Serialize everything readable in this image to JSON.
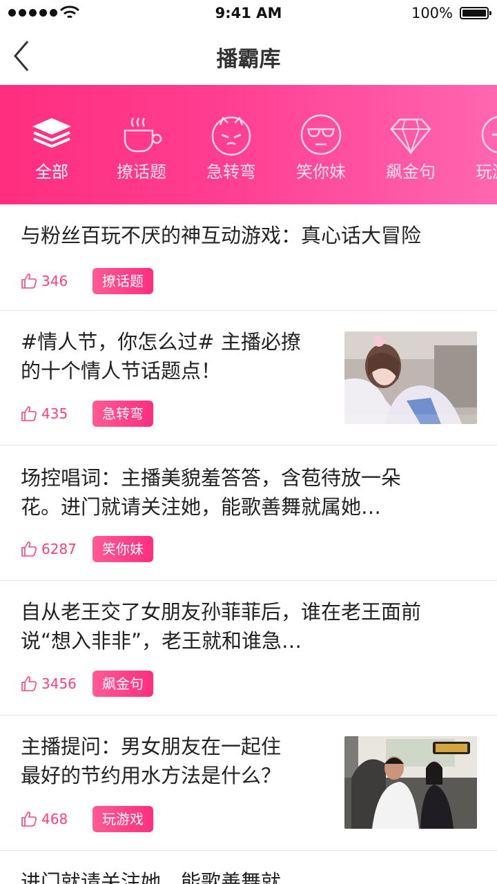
{
  "status_bar": {
    "time": "9:41 AM",
    "battery": "100%"
  },
  "nav": {
    "title": "播霸库"
  },
  "categories": [
    {
      "label": "全部",
      "icon": "layers-icon"
    },
    {
      "label": "撩话题",
      "icon": "coffee-cup-icon"
    },
    {
      "label": "急转弯",
      "icon": "cat-face-icon"
    },
    {
      "label": "笑你妹",
      "icon": "sunglasses-face-icon"
    },
    {
      "label": "飙金句",
      "icon": "diamond-icon"
    },
    {
      "label": "玩游戏",
      "icon": "gamepad-icon"
    }
  ],
  "items": [
    {
      "line1": "与粉丝百玩不厌的神互动游戏：真心话大冒险",
      "line2": "",
      "likes": "346",
      "tag": "撩话题",
      "thumb": ""
    },
    {
      "line1": "#情人节，你怎么过#  主播必撩",
      "line2": "的十个情人节话题点！",
      "likes": "435",
      "tag": "急转弯",
      "thumb": "girl-photo"
    },
    {
      "line1": "场控唱词：主播美貌羞答答，含苞待放一朵",
      "line2": "花。进门就请关注她，能歌善舞就属她…",
      "likes": "6287",
      "tag": "笑你妹",
      "thumb": ""
    },
    {
      "line1": "自从老王交了女朋友孙菲菲后，谁在老王面前",
      "line2": "说“想入非非”，老王就和谁急…",
      "likes": "3456",
      "tag": "飙金句",
      "thumb": ""
    },
    {
      "line1": "主播提问：男女朋友在一起住",
      "line2": "最好的节约用水方法是什么？",
      "likes": "468",
      "tag": "玩游戏",
      "thumb": "car-photo"
    },
    {
      "line1": "进门就请关注她，能歌善舞就",
      "line2": "",
      "likes": "",
      "tag": "",
      "thumb": ""
    }
  ]
}
